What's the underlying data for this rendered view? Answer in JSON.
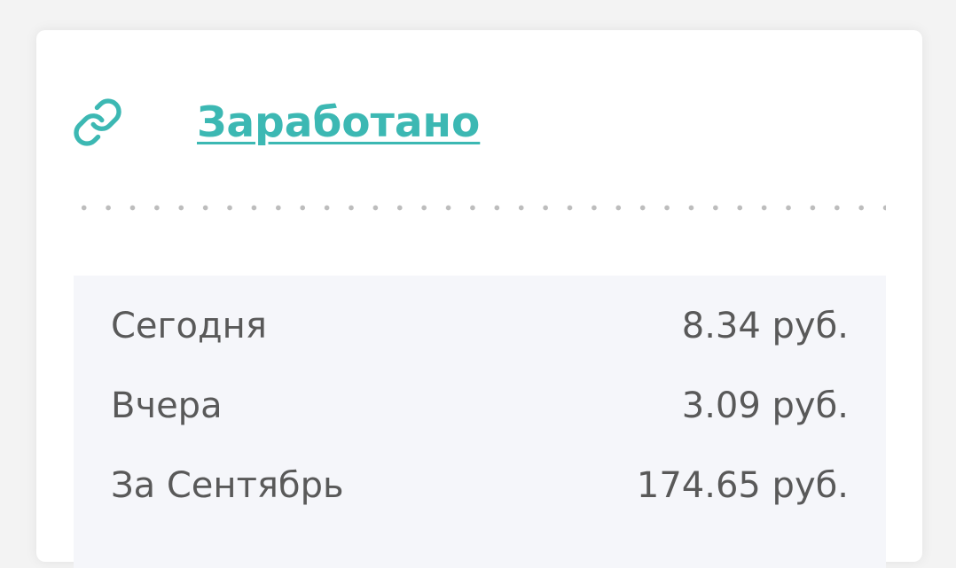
{
  "card": {
    "icon": "link-icon",
    "title": "Заработано",
    "accent_color": "#3cb8b3"
  },
  "stats": [
    {
      "label": "Сегодня",
      "value": "8.34 руб."
    },
    {
      "label": "Вчера",
      "value": "3.09 руб."
    },
    {
      "label": "За Сентябрь",
      "value": "174.65 руб."
    }
  ]
}
